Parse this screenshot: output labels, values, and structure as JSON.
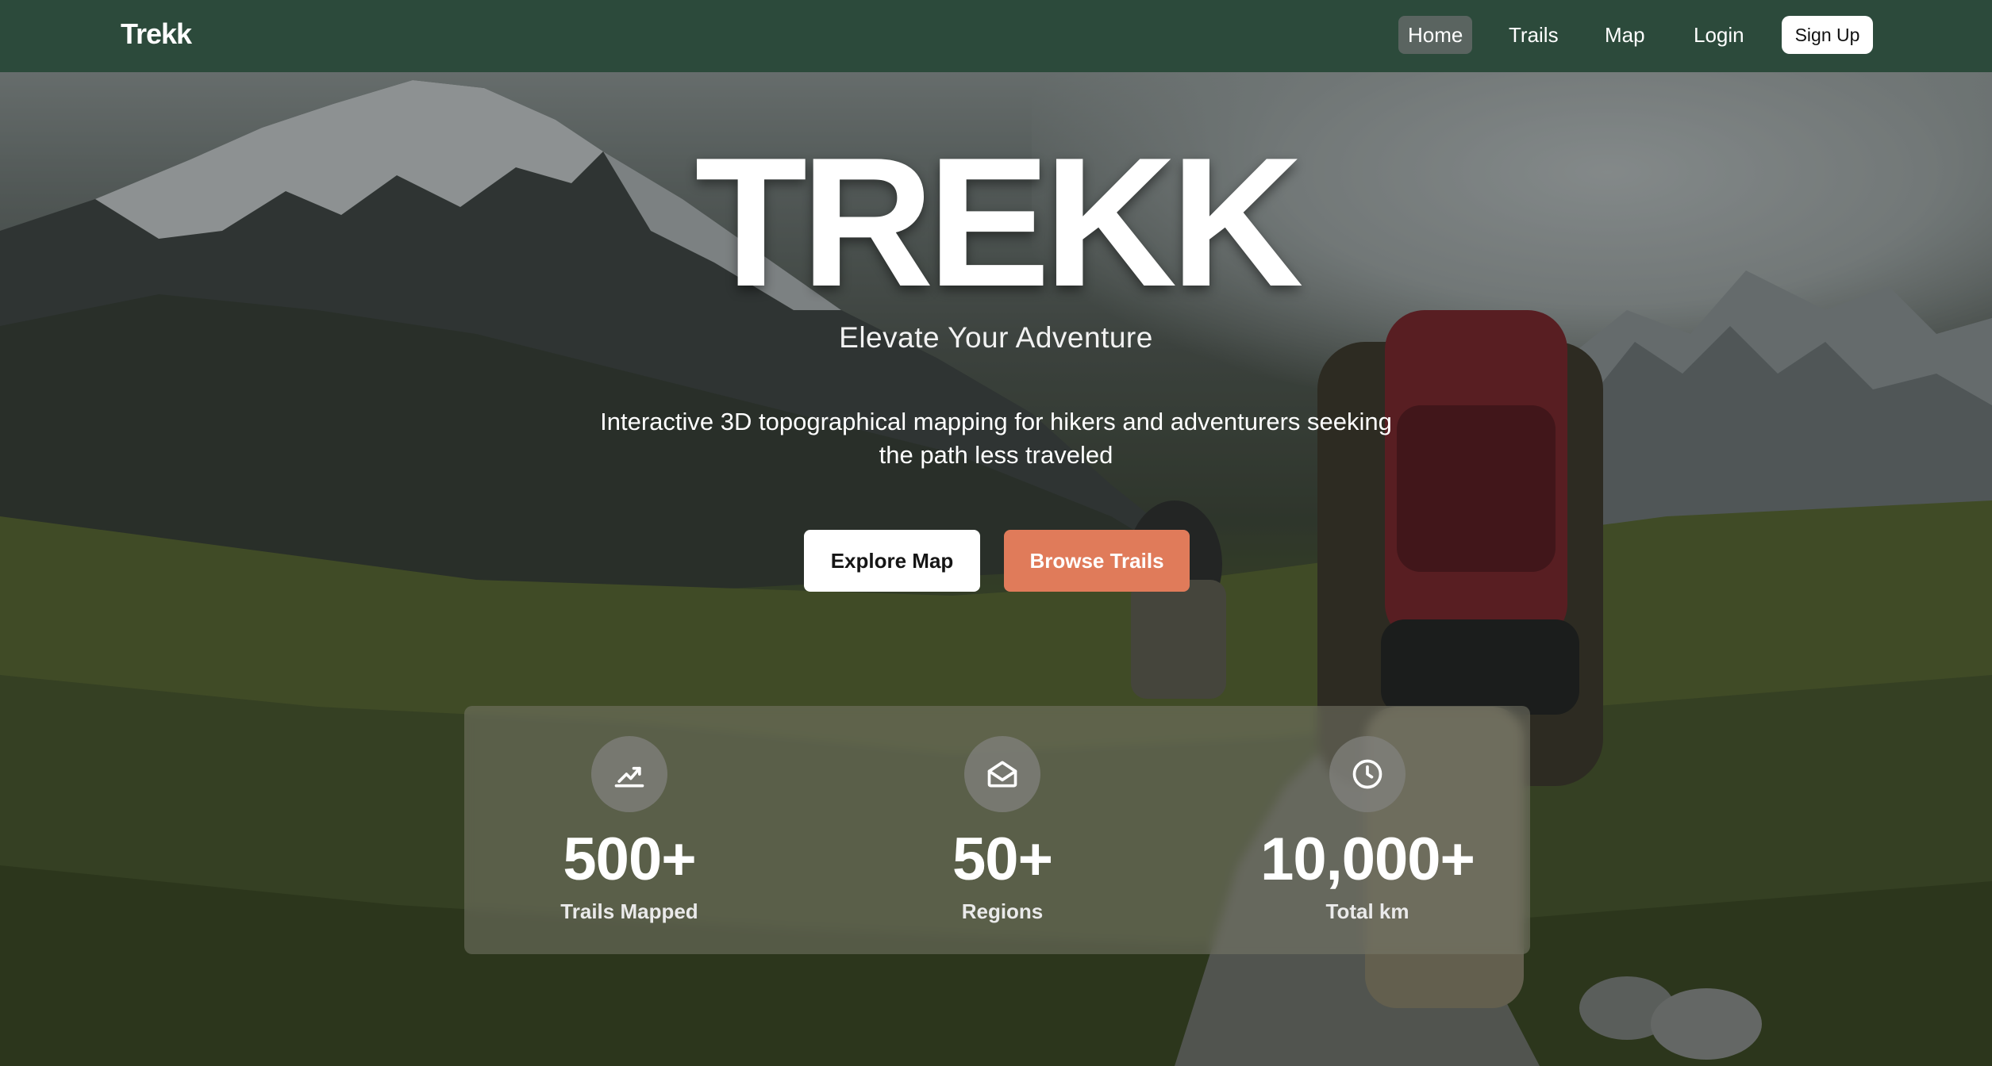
{
  "nav": {
    "brand": "Trekk",
    "items": [
      {
        "label": "Home"
      },
      {
        "label": "Trails"
      },
      {
        "label": "Map"
      },
      {
        "label": "Login"
      }
    ],
    "signup_label": "Sign Up"
  },
  "hero": {
    "title": "TREKK",
    "tagline": "Elevate Your Adventure",
    "description": "Interactive 3D topographical mapping for hikers and adventurers seeking the path less traveled",
    "primary_button": "Explore Map",
    "secondary_button": "Browse Trails"
  },
  "stats": [
    {
      "icon": "chart-up-icon",
      "value": "500+",
      "label": "Trails Mapped"
    },
    {
      "icon": "envelope-open-icon",
      "value": "50+",
      "label": "Regions"
    },
    {
      "icon": "clock-icon",
      "value": "10,000+",
      "label": "Total km"
    }
  ],
  "colors": {
    "nav_bg": "#2c4a3b",
    "accent": "#e07b5a",
    "active_nav": "#5a6460"
  }
}
